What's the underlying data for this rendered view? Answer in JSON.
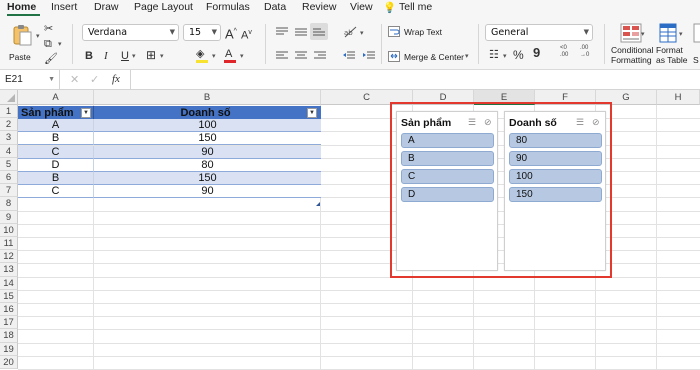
{
  "tabs": [
    "Home",
    "Insert",
    "Draw",
    "Page Layout",
    "Formulas",
    "Data",
    "Review",
    "View"
  ],
  "tell_me": "Tell me",
  "ribbon": {
    "paste_label": "Paste",
    "font_name": "Verdana",
    "font_size": "15",
    "wrap_text": "Wrap Text",
    "merge_center": "Merge & Center",
    "number_format": "General",
    "conditional_formatting": [
      "Conditional",
      "Formatting"
    ],
    "format_as_table": [
      "Format",
      "as Table"
    ],
    "bold": "B",
    "italic": "I",
    "underline": "U",
    "increase_font": "A",
    "decrease_font": "A",
    "percent": "%",
    "comma": "9",
    "inc_decimal": ".00",
    "dec_decimal": ".00",
    "more": "S"
  },
  "formula_bar": {
    "name_box": "E21",
    "fx": "fx",
    "value": ""
  },
  "columns": [
    "A",
    "B",
    "C",
    "D",
    "E",
    "F",
    "G",
    "H"
  ],
  "rows": [
    "1",
    "2",
    "3",
    "4",
    "5",
    "6",
    "7",
    "8",
    "9",
    "10",
    "11",
    "12",
    "13",
    "14",
    "15",
    "16",
    "17",
    "18",
    "19",
    "20"
  ],
  "table": {
    "headers": [
      "Sản phẩm",
      "Doanh số"
    ],
    "rows": [
      [
        "A",
        "100"
      ],
      [
        "B",
        "150"
      ],
      [
        "C",
        "90"
      ],
      [
        "D",
        "80"
      ],
      [
        "B",
        "150"
      ],
      [
        "C",
        "90"
      ]
    ]
  },
  "slicers": [
    {
      "title": "Sản phẩm",
      "items": [
        "A",
        "B",
        "C",
        "D"
      ]
    },
    {
      "title": "Doanh số",
      "items": [
        "80",
        "90",
        "100",
        "150"
      ]
    }
  ],
  "colors": {
    "accent_green": "#217346",
    "table_header": "#4472c4",
    "slicer_item": "#b7c9e2",
    "highlight_box": "#e2382e"
  }
}
